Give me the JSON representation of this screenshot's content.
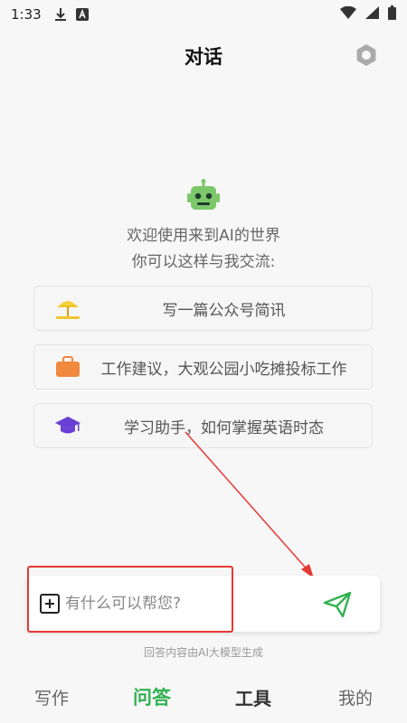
{
  "status_bar": {
    "time": "1:33",
    "icons": [
      "download-icon",
      "notification-a-icon",
      "wifi-icon",
      "signal-icon",
      "battery-icon"
    ]
  },
  "header": {
    "title": "对话",
    "settings_icon": "gear-icon"
  },
  "welcome": {
    "line1": "欢迎使用来到AI的世界",
    "line2": "你可以这样与我交流:"
  },
  "suggestions": [
    {
      "icon": "beach-umbrella-icon",
      "label": "写一篇公众号简讯"
    },
    {
      "icon": "briefcase-icon",
      "label": "工作建议，大观公园小吃摊投标工作"
    },
    {
      "icon": "graduation-cap-icon",
      "label": "学习助手，如何掌握英语时态"
    }
  ],
  "input": {
    "placeholder": "有什么可以帮您?",
    "value": ""
  },
  "disclaimer": "回答内容由AI大模型生成",
  "tabs": [
    {
      "label": "写作",
      "active": false
    },
    {
      "label": "问答",
      "active": true
    },
    {
      "label": "工具",
      "active": false
    },
    {
      "label": "我的",
      "active": false
    }
  ],
  "colors": {
    "accent": "#33b151",
    "highlight": "#e53935",
    "background": "#f7f7f7"
  }
}
